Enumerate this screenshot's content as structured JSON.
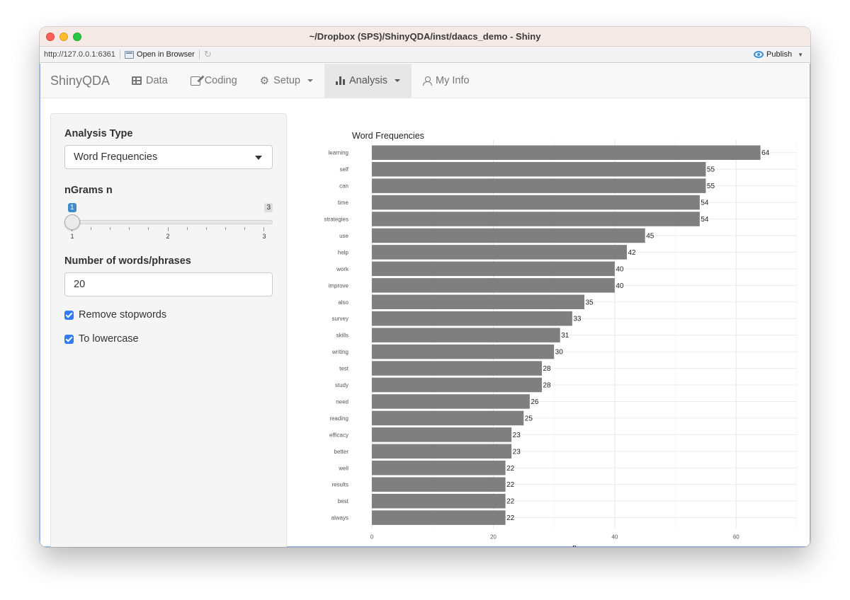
{
  "window": {
    "title": "~/Dropbox (SPS)/ShinyQDA/inst/daacs_demo - Shiny"
  },
  "addressbar": {
    "url": "http://127.0.0.1:6361",
    "open_in_browser": "Open in Browser",
    "publish": "Publish"
  },
  "navbar": {
    "brand": "ShinyQDA",
    "items": [
      {
        "label": "Data",
        "icon": "table-icon",
        "active": false,
        "dropdown": false
      },
      {
        "label": "Coding",
        "icon": "edit-icon",
        "active": false,
        "dropdown": false
      },
      {
        "label": "Setup",
        "icon": "gears-icon",
        "active": false,
        "dropdown": true
      },
      {
        "label": "Analysis",
        "icon": "bar-chart-icon",
        "active": true,
        "dropdown": true
      },
      {
        "label": "My Info",
        "icon": "user-icon",
        "active": false,
        "dropdown": false
      }
    ]
  },
  "sidebar": {
    "analysis_type_label": "Analysis Type",
    "analysis_type_value": "Word Frequencies",
    "ngrams_label": "nGrams n",
    "ngrams_slider": {
      "min": 1,
      "max": 3,
      "value": 1,
      "min_label": "1",
      "max_label": "3",
      "value_label": "1",
      "tick_labels": [
        "1",
        "2",
        "3"
      ]
    },
    "num_words_label": "Number of words/phrases",
    "num_words_value": "20",
    "remove_stopwords_label": "Remove stopwords",
    "remove_stopwords_checked": true,
    "lowercase_label": "To lowercase",
    "lowercase_checked": true
  },
  "chart_data": {
    "type": "bar",
    "orientation": "horizontal",
    "title": "Word Frequencies",
    "xlabel": "n",
    "ylabel": "",
    "xlim": [
      0,
      70
    ],
    "x_ticks": [
      0,
      20,
      40,
      60
    ],
    "grid": true,
    "bar_color": "#7f7f7f",
    "categories": [
      "learning",
      "self",
      "can",
      "time",
      "strategies",
      "use",
      "help",
      "work",
      "improve",
      "also",
      "survey",
      "skills",
      "writing",
      "test",
      "study",
      "need",
      "reading",
      "efficacy",
      "better",
      "well",
      "results",
      "best",
      "always"
    ],
    "values": [
      64,
      55,
      55,
      54,
      54,
      45,
      42,
      40,
      40,
      35,
      33,
      31,
      30,
      28,
      28,
      26,
      25,
      23,
      23,
      22,
      22,
      22,
      22
    ]
  }
}
